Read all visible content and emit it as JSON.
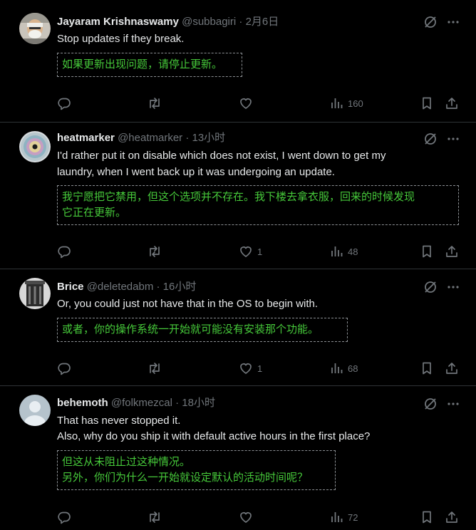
{
  "tweets": [
    {
      "name": "Jayaram Krishnaswamy",
      "handle": "@subbagiri",
      "separator": "·",
      "time": "2月6日",
      "text": [
        "Stop updates if they break."
      ],
      "translation": [
        "如果更新出现问题，请停止更新。"
      ],
      "replies": "",
      "retweets": "",
      "likes": "",
      "views": "160"
    },
    {
      "name": "heatmarker",
      "handle": "@heatmarker",
      "separator": "·",
      "time": "13小时",
      "text": [
        "I'd rather put it on disable which does not exist, I went down to get my",
        "laundry, when I went back up it was undergoing an update."
      ],
      "translation": [
        "我宁愿把它禁用，但这个选项并不存在。我下楼去拿衣服，回来的时候发现",
        "它正在更新。"
      ],
      "replies": "",
      "retweets": "",
      "likes": "1",
      "views": "48"
    },
    {
      "name": "Brice",
      "handle": "@deletedabm",
      "separator": "·",
      "time": "16小时",
      "text": [
        "Or, you could just not have that in the OS to begin with."
      ],
      "translation": [
        "或者，你的操作系统一开始就可能没有安装那个功能。"
      ],
      "replies": "",
      "retweets": "",
      "likes": "1",
      "views": "68"
    },
    {
      "name": "behemoth",
      "handle": "@folkmezcal",
      "separator": "·",
      "time": "18小时",
      "text": [
        "That has never stopped it.",
        "Also, why do you ship it with default active hours in the first place?"
      ],
      "translation": [
        "但这从未阻止过这种情况。",
        "另外，你们为什么一开始就设定默认的活动时间呢？"
      ],
      "replies": "",
      "retweets": "",
      "likes": "",
      "views": "72"
    }
  ],
  "icons": {
    "grok": "grok-icon",
    "more": "more-icon",
    "reply": "reply-icon",
    "retweet": "retweet-icon",
    "like": "like-icon",
    "views": "views-icon",
    "bookmark": "bookmark-icon",
    "share": "share-icon"
  },
  "colors": {
    "background": "#000000",
    "text": "#e7e9ea",
    "muted": "#71767b",
    "translation": "#46c93a",
    "divider": "#2f3336"
  }
}
